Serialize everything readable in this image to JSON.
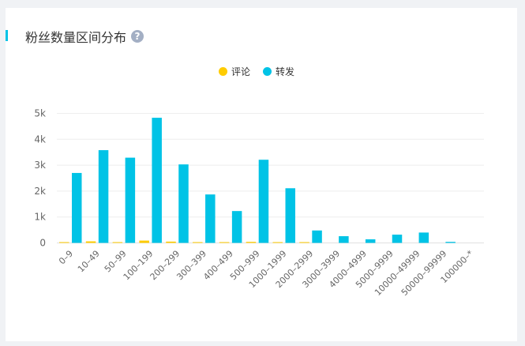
{
  "card": {
    "title": "粉丝数量区间分布",
    "help_icon": "?"
  },
  "chart_data": {
    "type": "bar",
    "title": "粉丝数量区间分布",
    "categories": [
      "0–9",
      "10–49",
      "50–99",
      "100–199",
      "200–299",
      "300–399",
      "400–499",
      "500–999",
      "1000–1999",
      "2000–2999",
      "3000–3999",
      "4000–4999",
      "5000–9999",
      "10000–49999",
      "50000–99999",
      "100000–*"
    ],
    "series": [
      {
        "name": "评论",
        "color": "#ffcc00",
        "values": [
          30,
          60,
          30,
          90,
          50,
          20,
          20,
          40,
          30,
          10,
          0,
          0,
          0,
          0,
          0,
          0
        ]
      },
      {
        "name": "转发",
        "color": "#00c3e6",
        "values": [
          2700,
          3580,
          3290,
          4830,
          3030,
          1870,
          1230,
          3210,
          2110,
          480,
          260,
          140,
          320,
          400,
          40,
          0
        ]
      }
    ],
    "yticks": [
      "0",
      "1k",
      "2k",
      "3k",
      "4k",
      "5k"
    ],
    "ylim": [
      0,
      5000
    ],
    "grid": true,
    "legend_position": "top-center",
    "xlabel": "",
    "ylabel": ""
  }
}
